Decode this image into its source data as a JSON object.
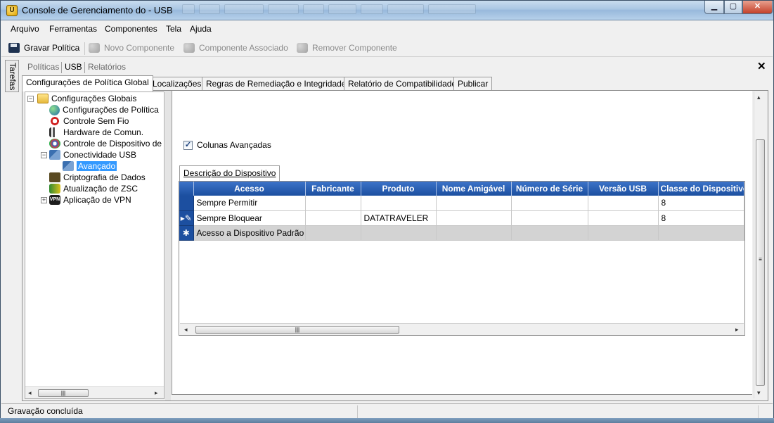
{
  "window": {
    "title": "Console de Gerenciamento do  - USB"
  },
  "menu": [
    "Arquivo",
    "Ferramentas",
    "Componentes",
    "Tela",
    "Ajuda"
  ],
  "toolbar": {
    "save": "Gravar Política",
    "new_component": "Novo Componente",
    "associated_component": "Componente Associado",
    "remove_component": "Remover Componente"
  },
  "tasks_label": "Tarefas",
  "view_tabs": [
    "Políticas",
    "USB",
    "Relatórios"
  ],
  "policy_tabs": [
    "Configurações de Política Global",
    "Localizações",
    "Regras de Remediação e Integridade",
    "Relatório de Compatibilidade",
    "Publicar"
  ],
  "tree": {
    "root": "Configurações Globais",
    "items": [
      "Configurações de Política",
      "Controle Sem Fio",
      "Hardware de Comun.",
      "Controle de Dispositivo de",
      "Conectividade USB",
      "Avançado",
      "Criptografia de Dados",
      "Atualização de ZSC",
      "Aplicação de VPN"
    ]
  },
  "advanced": {
    "checkbox_label": "Colunas Avançadas",
    "checkbox_checked": true,
    "device_tab": "Descrição do Dispositivo"
  },
  "grid": {
    "columns": [
      "Acesso",
      "Fabricante",
      "Produto",
      "Nome Amigável",
      "Número de Série",
      "Versão USB",
      "Classe do Dispositivo"
    ],
    "rows": [
      {
        "marker": "",
        "acesso": "Sempre Permitir",
        "fabricante": "",
        "produto": "",
        "nome": "",
        "serie": "",
        "versao": "",
        "classe": "8"
      },
      {
        "marker": "▸✎",
        "acesso": "Sempre Bloquear",
        "fabricante": "",
        "produto": "DATATRAVELER",
        "nome": "",
        "serie": "",
        "versao": "",
        "classe": "8"
      },
      {
        "marker": "✱",
        "acesso": "Acesso a Dispositivo Padrão",
        "fabricante": "",
        "produto": "",
        "nome": "",
        "serie": "",
        "versao": "",
        "classe": ""
      }
    ]
  },
  "status": "Gravação concluída"
}
